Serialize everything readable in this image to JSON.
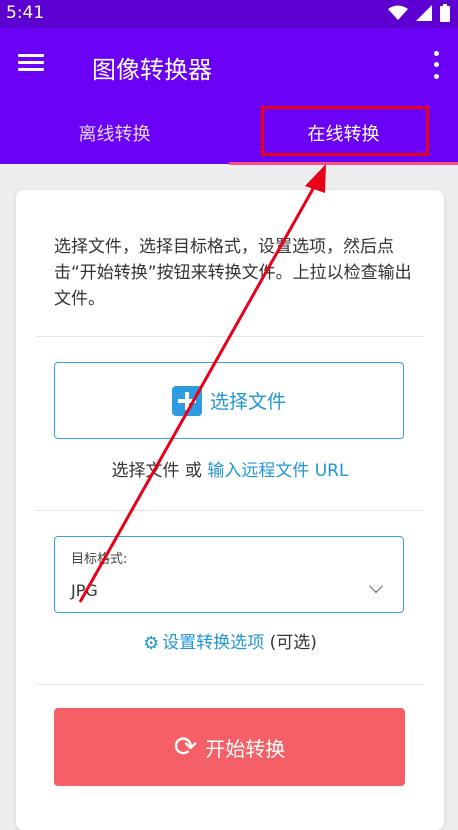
{
  "status_bar": {
    "time": "5:41"
  },
  "app_bar": {
    "title": "图像转换器"
  },
  "tabs": [
    {
      "label": "离线转换"
    },
    {
      "label": "在线转换"
    }
  ],
  "card": {
    "instructions": "选择文件，选择目标格式，设置选项，然后点击“开始转换”按钮来转换文件。上拉以检查输出文件。",
    "select_file_label": "选择文件",
    "file_line_prefix": "选择文件 或 ",
    "remote_url_link": "输入远程文件 URL",
    "target_format_label": "目标格式:",
    "target_format_value": "JPG",
    "options_link": "设置转换选项",
    "options_suffix": " (可选)",
    "start_button_label": "开始转换"
  },
  "icons": {
    "menu": "menu-icon",
    "more": "more-vert-icon",
    "wifi": "wifi-icon",
    "signal": "signal-icon",
    "battery": "battery-icon",
    "plus": "plus-icon",
    "gear": "gear-icon",
    "sync": "sync-icon",
    "dropdown": "chevron-down-icon"
  },
  "colors": {
    "app_bar": "#6a00f4",
    "status_bar": "#5c00d2",
    "tab_indicator": "#ff4f8b",
    "link": "#2196d6",
    "start_button": "#f46066",
    "annotation": "#e8001b"
  }
}
